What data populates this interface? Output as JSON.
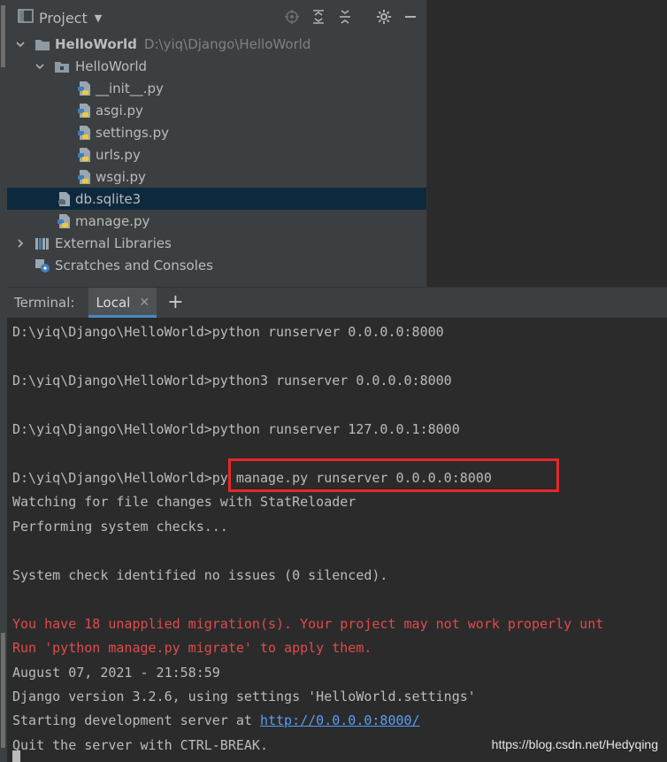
{
  "project_panel": {
    "title": "Project",
    "tree": [
      {
        "label": "HelloWorld",
        "path": "D:\\yiq\\Django\\HelloWorld",
        "icon": "folder-icon",
        "bold": true,
        "arrow": "down"
      },
      {
        "label": "HelloWorld",
        "icon": "package-folder-icon",
        "arrow": "down"
      },
      {
        "label": "__init__.py",
        "icon": "python-file-icon"
      },
      {
        "label": "asgi.py",
        "icon": "python-file-icon"
      },
      {
        "label": "settings.py",
        "icon": "python-file-icon"
      },
      {
        "label": "urls.py",
        "icon": "python-file-icon"
      },
      {
        "label": "wsgi.py",
        "icon": "python-file-icon"
      },
      {
        "label": "db.sqlite3",
        "icon": "database-file-icon",
        "selected": true
      },
      {
        "label": "manage.py",
        "icon": "python-file-icon"
      },
      {
        "label": "External Libraries",
        "icon": "library-icon",
        "arrow": "right"
      },
      {
        "label": "Scratches and Consoles",
        "icon": "scratches-icon"
      }
    ]
  },
  "terminal": {
    "label": "Terminal:",
    "tab": "Local",
    "add_label": "+",
    "lines": [
      {
        "text": "D:\\yiq\\Django\\HelloWorld>python runserver 0.0.0.0:8000"
      },
      {
        "text": ""
      },
      {
        "text": "D:\\yiq\\Django\\HelloWorld>python3 runserver 0.0.0.0:8000"
      },
      {
        "text": ""
      },
      {
        "text": "D:\\yiq\\Django\\HelloWorld>python runserver 127.0.0.1:8000"
      },
      {
        "text": ""
      },
      {
        "text": "D:\\yiq\\Django\\HelloWorld>py manage.py runserver 0.0.0.0:8000"
      },
      {
        "text": "Watching for file changes with StatReloader"
      },
      {
        "text": "Performing system checks..."
      },
      {
        "text": ""
      },
      {
        "text": "System check identified no issues (0 silenced)."
      },
      {
        "text": ""
      },
      {
        "text": "You have 18 unapplied migration(s). Your project may not work properly unt",
        "color": "red"
      },
      {
        "text": "Run 'python manage.py migrate' to apply them.",
        "color": "red"
      },
      {
        "text": "August 07, 2021 - 21:58:59"
      },
      {
        "text": "Django version 3.2.6, using settings 'HelloWorld.settings'"
      },
      {
        "text": "Starting development server at ",
        "link": "http://0.0.0.0:8000/"
      },
      {
        "text": "Quit the server with CTRL-BREAK."
      }
    ]
  },
  "watermark": "https://blog.csdn.net/Hedyqing",
  "colors": {
    "highlight_box": "#e8262a",
    "error_text": "#e04b4b",
    "link": "#589df6",
    "selection": "#0d293e"
  }
}
